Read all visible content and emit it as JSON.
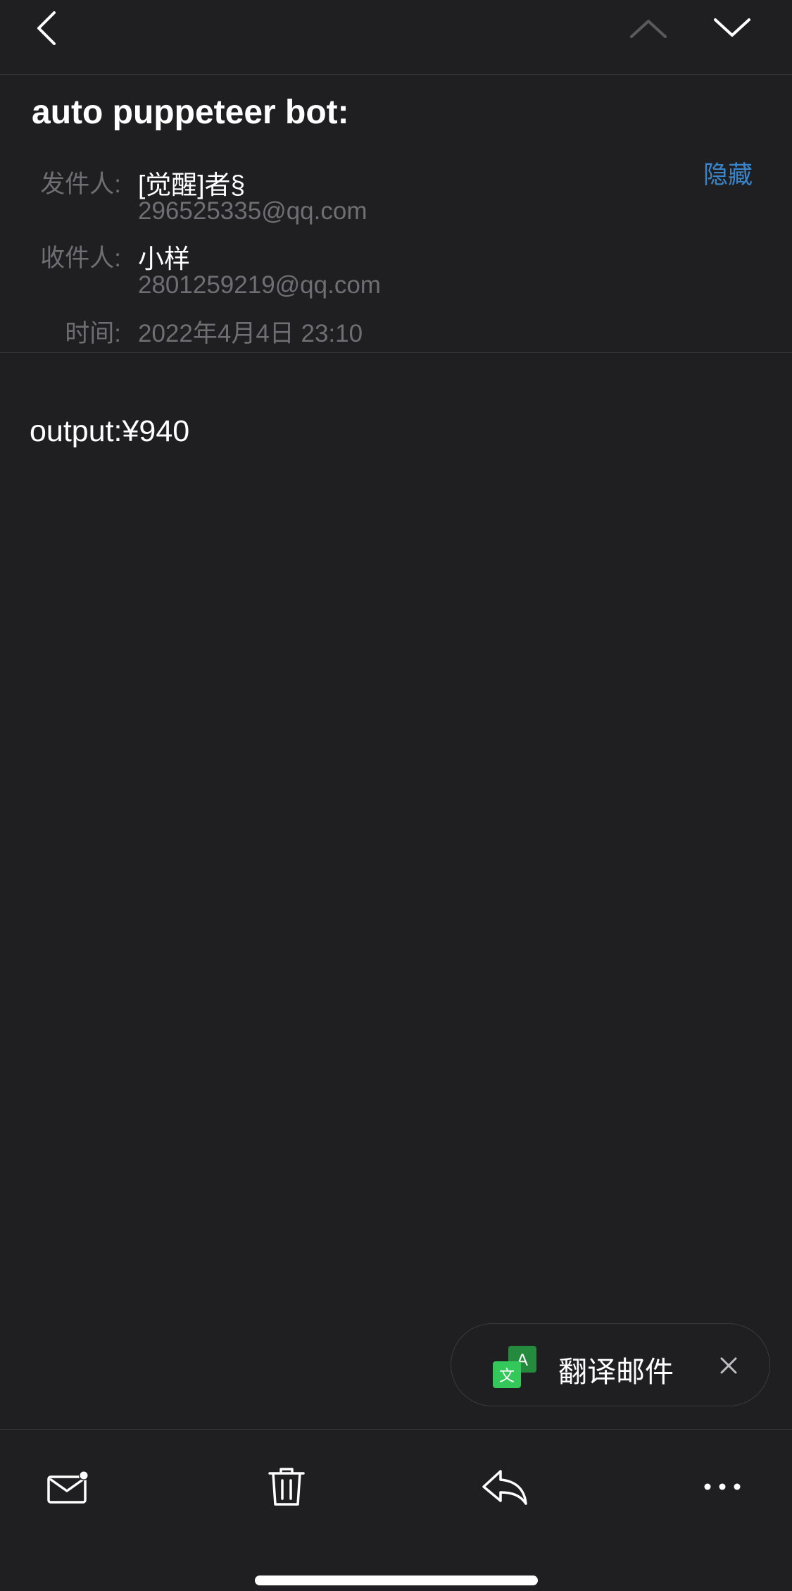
{
  "nav": {
    "back_icon": "chevron-left-icon",
    "prev_icon": "chevron-up-icon",
    "next_icon": "chevron-down-icon"
  },
  "header": {
    "subject": "auto puppeteer bot:",
    "hide_label": "隐藏",
    "from_label": "发件人",
    "from_name": "[觉醒]者§",
    "from_email": "296525335@qq.com",
    "to_label": "收件人",
    "to_name": "小样",
    "to_email": "2801259219@qq.com",
    "time_label": "时间",
    "time_value": "2022年4月4日 23:10",
    "label_colon": ":"
  },
  "body": {
    "text": "output:¥940"
  },
  "translate": {
    "label": "翻译邮件",
    "icon": "translate-icon",
    "close_icon": "close-icon",
    "accent_color": "#34c759"
  },
  "toolbar": {
    "items": [
      "mail-unread-icon",
      "trash-icon",
      "reply-icon",
      "more-icon"
    ]
  },
  "colors": {
    "background": "#1f1f21",
    "link": "#3a85c9",
    "secondary_text": "#6f6f73"
  }
}
